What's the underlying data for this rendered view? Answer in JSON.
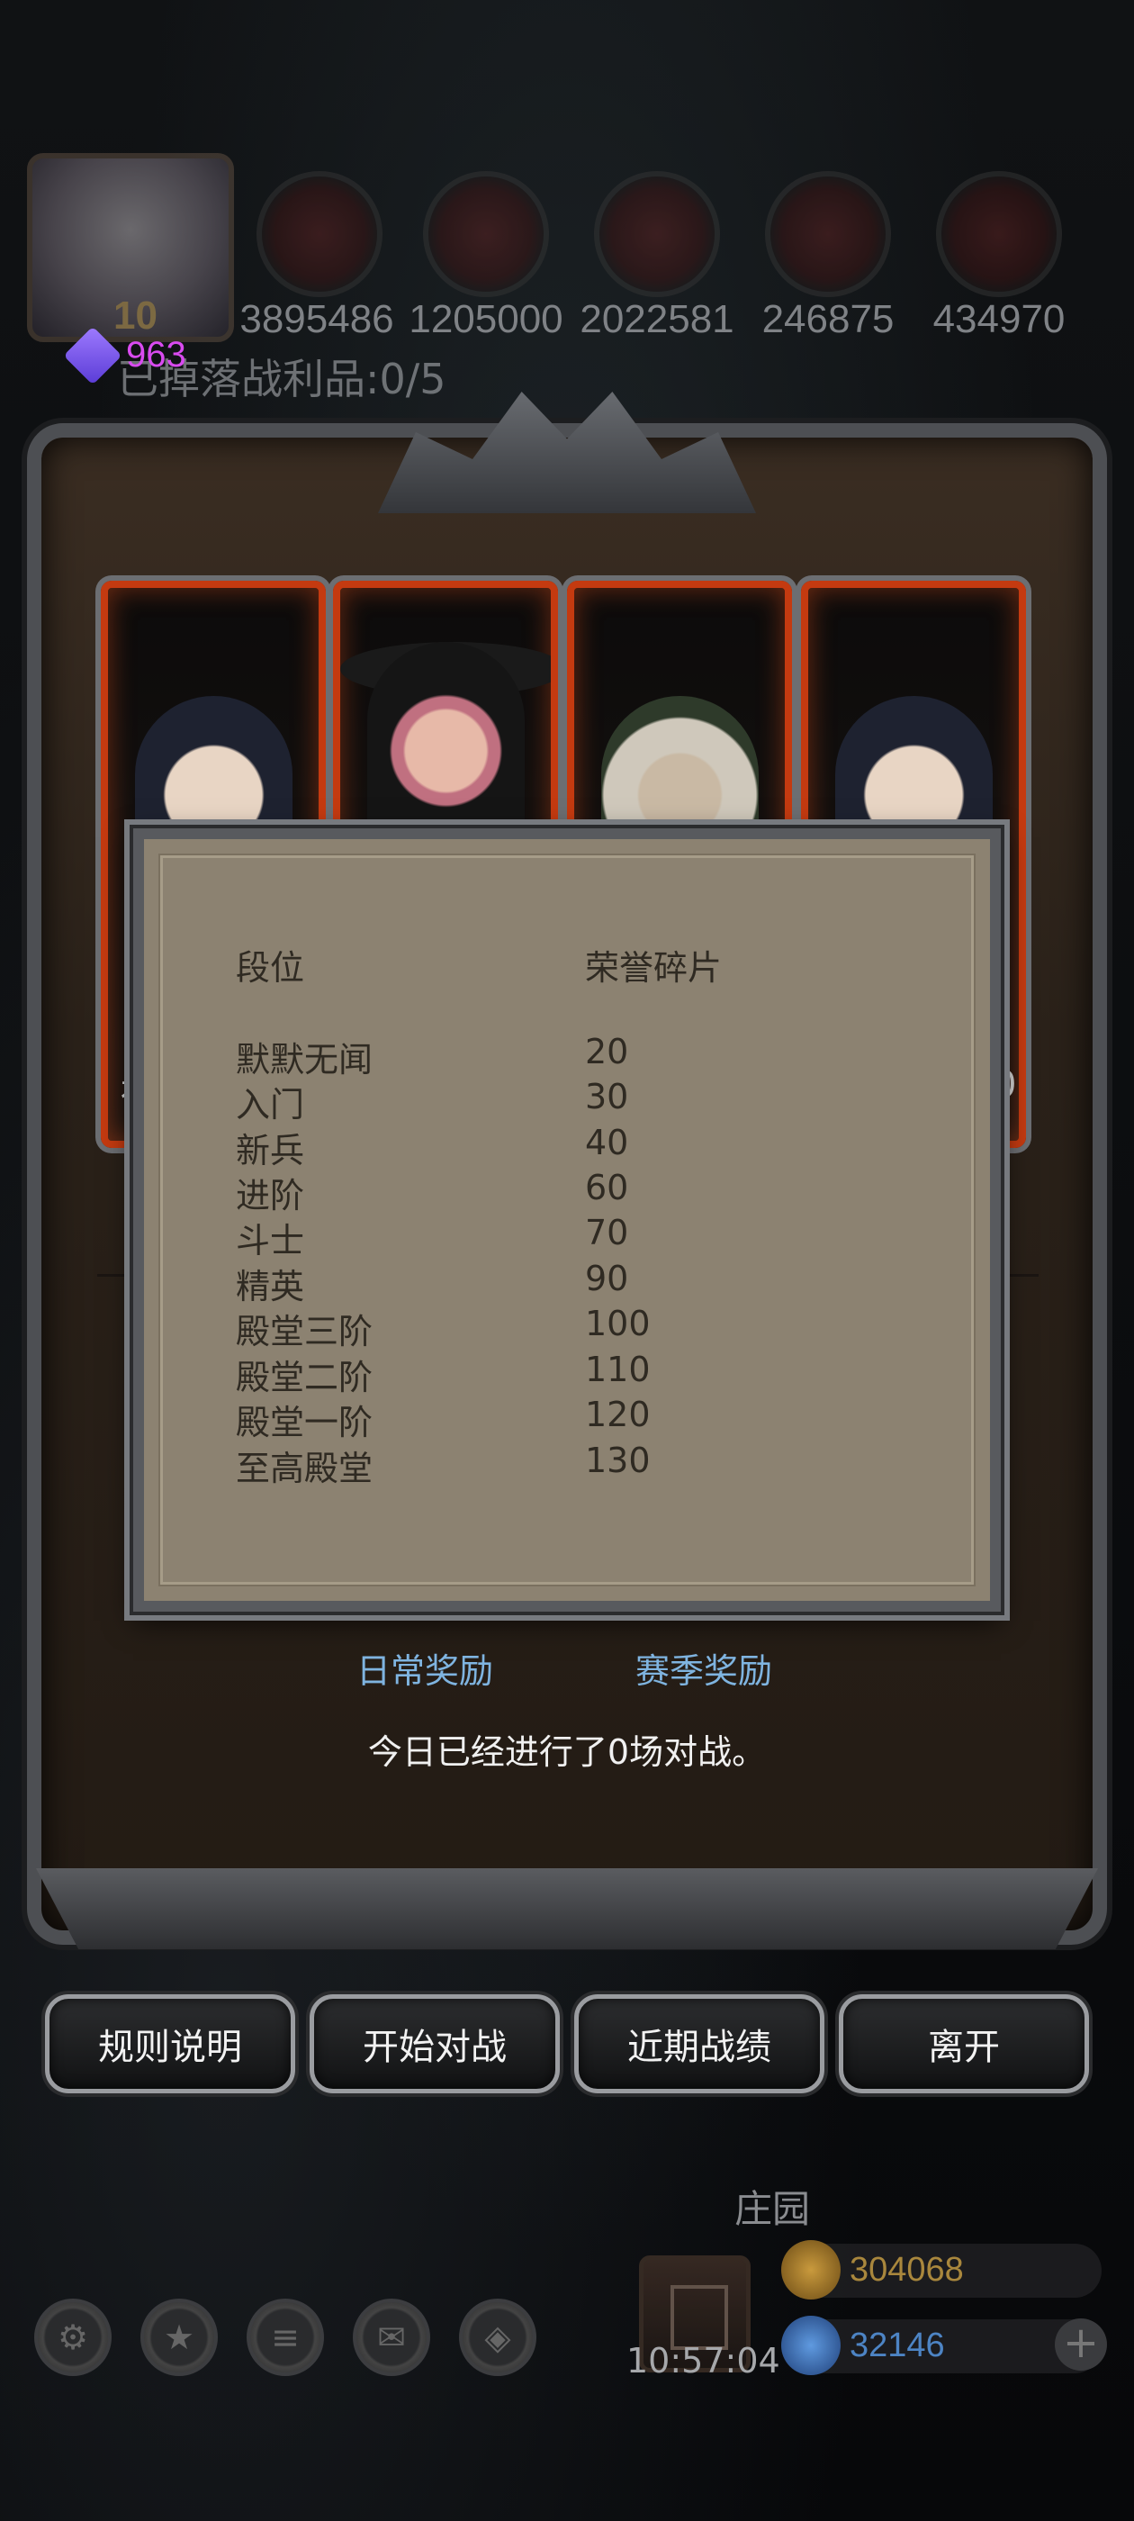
{
  "hud": {
    "level": "10",
    "resources": [
      {
        "icon": "meat-icon",
        "value": "3895486"
      },
      {
        "icon": "wood-icon",
        "value": "1205000"
      },
      {
        "icon": "iron-icon",
        "value": "2022581"
      },
      {
        "icon": "crystal-icon",
        "value": "246875"
      },
      {
        "icon": "ore-icon",
        "value": "434970"
      }
    ],
    "gems": "963",
    "loot_text": "已掉落战利品:0/5"
  },
  "cards": {
    "ghost_left": "祖",
    "ghost_right": "0"
  },
  "rank_dialog": {
    "header_rank": "段位",
    "header_reward": "荣誉碎片",
    "rows": [
      {
        "rank": "默默无闻",
        "shards": "20"
      },
      {
        "rank": "入门",
        "shards": "30"
      },
      {
        "rank": "新兵",
        "shards": "40"
      },
      {
        "rank": "进阶",
        "shards": "60"
      },
      {
        "rank": "斗士",
        "shards": "70"
      },
      {
        "rank": "精英",
        "shards": "90"
      },
      {
        "rank": "殿堂三阶",
        "shards": "100"
      },
      {
        "rank": "殿堂二阶",
        "shards": "110"
      },
      {
        "rank": "殿堂一阶",
        "shards": "120"
      },
      {
        "rank": "至高殿堂",
        "shards": "130"
      }
    ]
  },
  "rewards": {
    "daily": "日常奖励",
    "season": "赛季奖励",
    "status": "今日已经进行了0场对战。"
  },
  "buttons": {
    "rules": "规则说明",
    "start": "开始对战",
    "records": "近期战绩",
    "leave": "离开"
  },
  "bottom": {
    "estate": "庄园",
    "clock": "10:57:04",
    "gold": "304068",
    "diamonds": "32146",
    "plus": "+"
  },
  "colors": {
    "card_border": "#c43a10",
    "dialog_bg": "#8c8271",
    "link_blue": "#7fb4e0",
    "gem_purple": "#d94bf0",
    "gold_text": "#a9873d",
    "diamond_text": "#4d84c4"
  }
}
